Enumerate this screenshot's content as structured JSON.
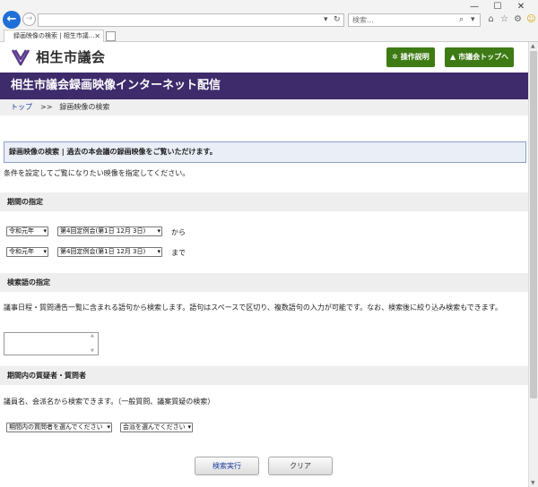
{
  "browser": {
    "tab_title": "録画映像の検索 | 相生市議...",
    "search_placeholder": "検索...",
    "window_controls": {
      "minimize": "—",
      "maximize": "☐",
      "close": "✕"
    }
  },
  "header": {
    "site_name": "相生市議会",
    "buttons": {
      "guide": "操作説明",
      "top": "市議会トップへ"
    }
  },
  "page_title": "相生市議会録画映像インターネット配信",
  "breadcrumb": {
    "home": "トップ",
    "separator": ">>",
    "current": "録画映像の検索"
  },
  "notice": "録画映像の検索 | 過去の本会議の録画映像をご覧いただけます。",
  "intro": "条件を設定してご覧になりたい映像を指定してください。",
  "period": {
    "heading": "期間の指定",
    "from": {
      "era": "令和元年",
      "session": "第4回定例会(第1日 12月 3日)",
      "suffix": "から"
    },
    "to": {
      "era": "令和元年",
      "session": "第4回定例会(第1日 12月 3日)",
      "suffix": "まで"
    }
  },
  "keyword": {
    "heading": "検索語の指定",
    "description": "議事日程・質問通告一覧に含まれる語句から検索します。語句はスペースで区切り、複数語句の入力が可能です。なお、検索後に絞り込み検索もできます。",
    "value": ""
  },
  "questioner": {
    "heading": "期間内の質疑者・質問者",
    "description": "議員名、会派名から検索できます。（一般質問、議案質疑の検索）",
    "member_select": "期間内の質問者を選んでください",
    "faction_select": "会派を選んでください"
  },
  "actions": {
    "search": "検索実行",
    "clear": "クリア"
  },
  "colors": {
    "brand_purple": "#3d2b6b",
    "button_green": "#3e7b14",
    "link_blue": "#1a3d9e"
  }
}
